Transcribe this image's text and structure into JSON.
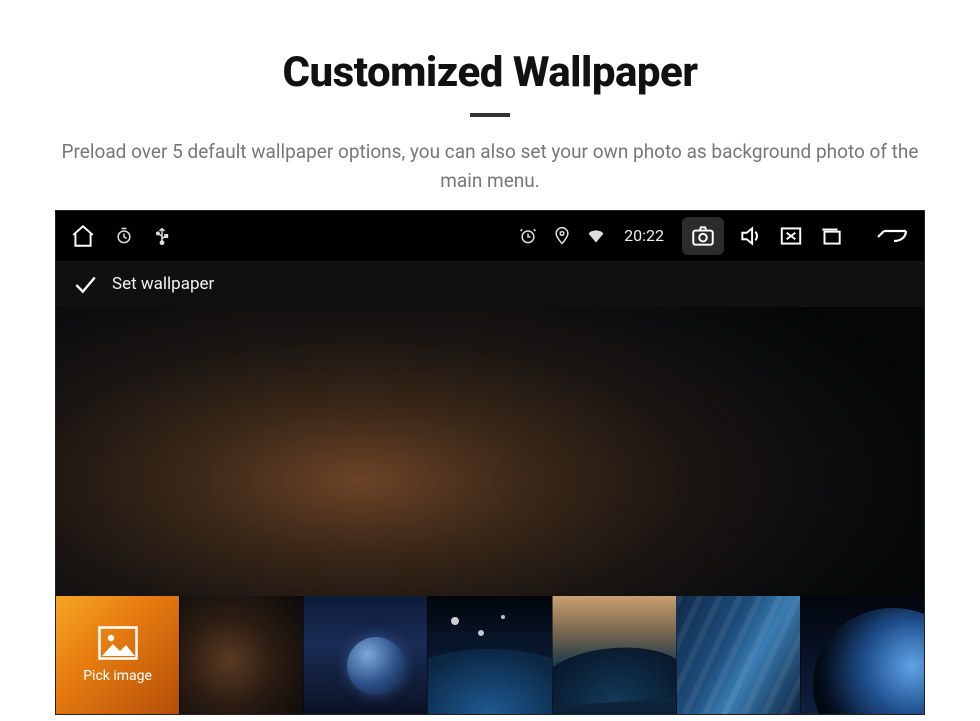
{
  "headline": {
    "title": "Customized Wallpaper",
    "description": "Preload over 5 default wallpaper options, you can also set your own photo as background photo of the main menu."
  },
  "statusbar": {
    "time": "20:22"
  },
  "screen": {
    "title": "Set wallpaper",
    "pick_label": "Pick image"
  }
}
